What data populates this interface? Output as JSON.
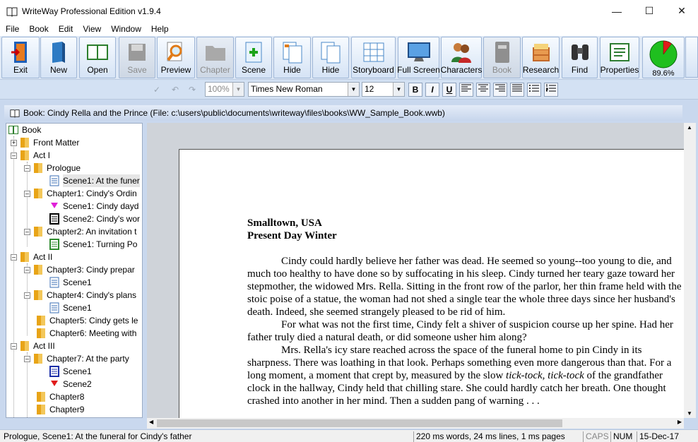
{
  "window": {
    "title": "WriteWay Professional Edition v1.9.4"
  },
  "menu": [
    "File",
    "Book",
    "Edit",
    "View",
    "Window",
    "Help"
  ],
  "toolbar": {
    "exit": "Exit",
    "new": "New",
    "open": "Open",
    "save": "Save",
    "preview": "Preview",
    "chapter": "Chapter",
    "scene": "Scene",
    "hide1": "Hide",
    "hide2": "Hide",
    "storyboard": "Storyboard",
    "fullscreen": "Full Screen",
    "characters": "Characters",
    "book": "Book",
    "research": "Research",
    "find": "Find",
    "properties": "Properties",
    "progress": "89.6%",
    "progress_value": 0.896
  },
  "format": {
    "zoom": "100%",
    "font": "Times New Roman",
    "size": "12",
    "bold": "B",
    "italic": "I",
    "underline": "U"
  },
  "book_header": "Book: Cindy Rella and the Prince (File: c:\\users\\public\\documents\\writeway\\files\\books\\WW_Sample_Book.wwb)",
  "tree": {
    "book": "Book",
    "front_matter": "Front Matter",
    "act1": "Act I",
    "prologue": "Prologue",
    "prologue_scene1": "Scene1: At the funer",
    "ch1": "Chapter1: Cindy's Ordin",
    "ch1_s1": "Scene1: Cindy dayd",
    "ch1_s2": "Scene2: Cindy's wor",
    "ch2": "Chapter2: An invitation t",
    "ch2_s1": "Scene1: Turning Po",
    "act2": "Act II",
    "ch3": "Chapter3: Cindy prepar",
    "ch3_s1": "Scene1",
    "ch4": "Chapter4: Cindy's plans",
    "ch4_s1": "Scene1",
    "ch5": "Chapter5: Cindy gets le",
    "ch6": "Chapter6: Meeting with",
    "act3": "Act III",
    "ch7": "Chapter7: At the party",
    "ch7_s1": "Scene1",
    "ch7_s2": "Scene2",
    "ch8": "Chapter8",
    "ch9": "Chapter9"
  },
  "document": {
    "heading1": "Smalltown, USA",
    "heading2": "Present Day Winter",
    "para1": "Cindy could hardly believe her father was dead. He seemed so young--too young to die, and much too healthy to have done so by suffocating in his sleep. Cindy turned her teary gaze toward her stepmother, the widowed Mrs. Rella. Sitting in the front row of the parlor, her thin frame held with the stoic poise of a statue, the woman had not shed a single tear the whole three days since her husband's death. Indeed, she seemed strangely pleased to be rid of him.",
    "para2": "For what was not the first time, Cindy felt a shiver of suspicion course up her spine. Had her father truly died a natural death, or did someone usher him along?",
    "para3a": "Mrs. Rella's icy stare reached across the space of the funeral home to pin Cindy in its sharpness. There was loathing in that look. Perhaps something even more dangerous than that. For a long moment, a moment that crept by, measured by the slow ",
    "para3_italic": "tick-tock, tick-tock",
    "para3b": " of the grandfather clock in the hallway, Cindy held that chilling stare. She could hardly catch her breath. One thought crashed into another in her mind. Then a sudden pang of warning . . ."
  },
  "status": {
    "location": "Prologue, Scene1: At the funeral for Cindy's father",
    "timing": "220 ms words, 24 ms lines, 1 ms pages",
    "caps": "CAPS",
    "num": "NUM",
    "date": "15-Dec-17"
  }
}
